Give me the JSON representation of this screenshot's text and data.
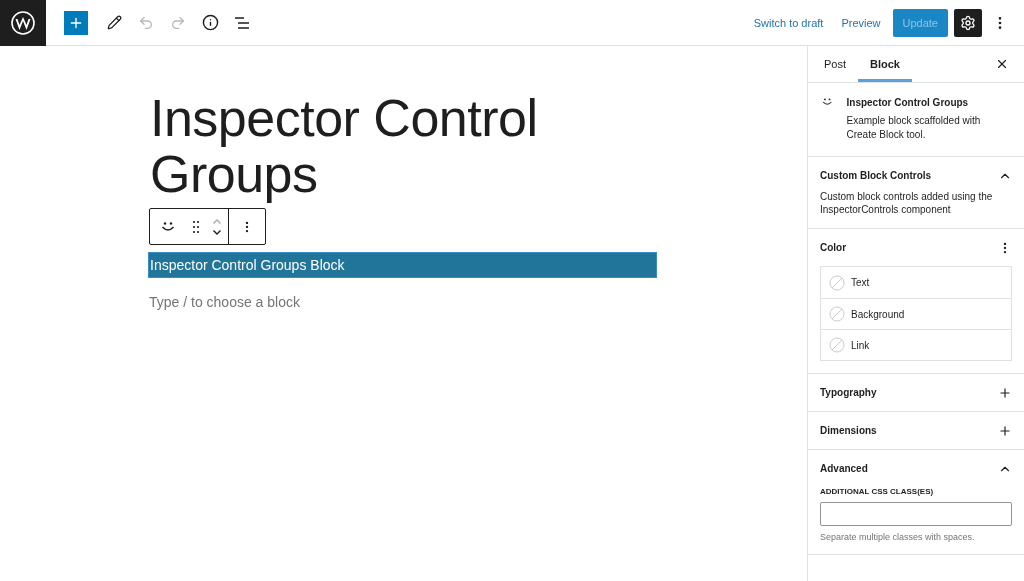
{
  "topbar": {
    "undo": {
      "disabled": true
    },
    "redo": {
      "disabled": true
    },
    "links": [
      "Switch to draft",
      "Preview"
    ],
    "update_button": {
      "label": "Update",
      "disabled": true
    },
    "settings": {
      "pressed": true
    }
  },
  "editor": {
    "title": "Inspector Control Groups",
    "selected_block": "Inspector Control Groups Block",
    "appender": {
      "placeholder": "Type / to choose a block"
    }
  },
  "sidebar": {
    "tabs": [
      {
        "label": "Post",
        "selected": false
      },
      {
        "label": "Block",
        "selected": true
      }
    ],
    "block_card": {
      "title": "Inspector Control Groups",
      "description": "Example block scaffolded with Create Block tool."
    },
    "panels": [
      {
        "kind": "text",
        "title": "Custom Block Controls",
        "expanded": true,
        "description": "Custom block controls added using the InspectorControls component"
      },
      {
        "kind": "color",
        "title": "Color",
        "items": [
          "Text",
          "Background",
          "Link"
        ]
      },
      {
        "kind": "text",
        "title": "Typography",
        "expanded": false
      },
      {
        "kind": "text",
        "title": "Dimensions",
        "expanded": false
      },
      {
        "kind": "field",
        "title": "Advanced",
        "expanded": true,
        "field": {
          "label": "ADDITIONAL CSS CLASS(ES)",
          "help": "Separate multiple classes with spaces."
        }
      }
    ]
  }
}
